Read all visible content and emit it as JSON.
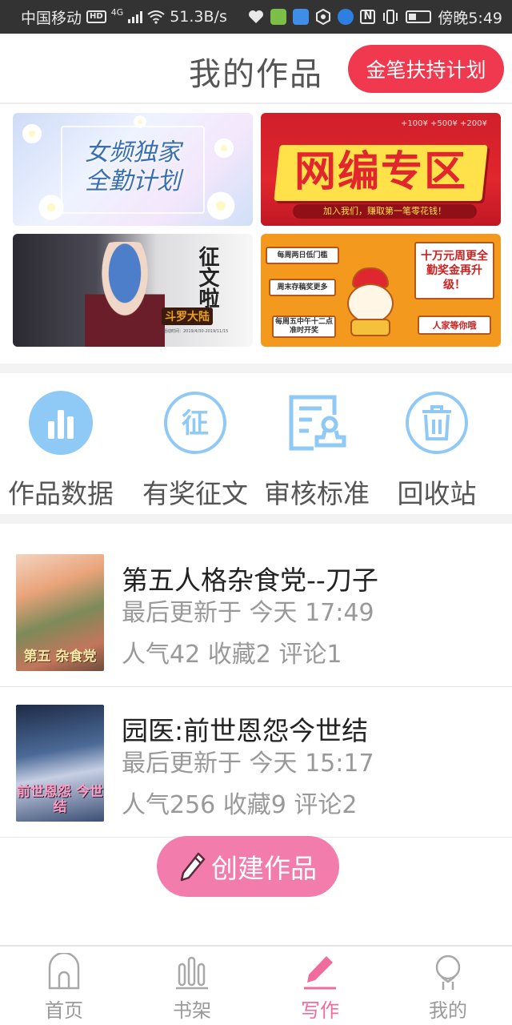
{
  "status_bar": {
    "carrier": "中国移动",
    "hd_badge": "HD",
    "network": "4G",
    "speed": "51.3B/s",
    "time": "傍晚5:49"
  },
  "header": {
    "title": "我的作品",
    "plan_button": "金笔扶持计划"
  },
  "banners": [
    {
      "name": "女频独家全勤计划",
      "title_line1": "女频独家",
      "title_line2": "全勤计划",
      "bg_color": "#dfe8fb"
    },
    {
      "name": "网编专区",
      "title": "网编专区",
      "tagline": "加入我们，赚取第一笔零花钱！",
      "coins": "+100¥  +500¥  +200¥",
      "bg_color": "#d11f2a"
    },
    {
      "name": "征文啦 斗罗大陆",
      "title": "征文啦",
      "tag": "斗罗大陆",
      "sub": "活动时间：2019/4/30-2019/11/15",
      "bg_color": "#f7f7f7"
    },
    {
      "name": "十万元周更全勤奖金",
      "box1": "每周两日低门槛",
      "box2": "周末存稿奖更多",
      "box3": "每周五中午十二点准时开奖",
      "big": "十万元周更全勤奖金再升级！",
      "cta": "人家等你哦",
      "bg_color": "#f39a1e"
    }
  ],
  "features": [
    {
      "label": "作品数据",
      "icon": "bar-chart-icon"
    },
    {
      "label": "有奖征文",
      "icon": "contest-icon",
      "glyph": "征"
    },
    {
      "label": "审核标准",
      "icon": "review-standard-icon"
    },
    {
      "label": "回收站",
      "icon": "trash-icon"
    }
  ],
  "works": [
    {
      "title": "第五人格杂食党--刀子",
      "updated": "最后更新于 今天 17:49",
      "stats": "人气42 收藏2 评论1",
      "cover_text": "第五 杂食党"
    },
    {
      "title": "园医:前世恩怨今世结",
      "updated": "最后更新于 今天 15:17",
      "stats": "人气256 收藏9 评论2",
      "cover_text": "前世恩怨 今世结"
    }
  ],
  "create_button": "创建作品",
  "tabs": [
    {
      "label": "首页",
      "icon": "home-icon",
      "active": false
    },
    {
      "label": "书架",
      "icon": "bookshelf-icon",
      "active": false
    },
    {
      "label": "写作",
      "icon": "pencil-icon",
      "active": true
    },
    {
      "label": "我的",
      "icon": "profile-icon",
      "active": false
    }
  ],
  "colors": {
    "accent_pink": "#ef6c9d",
    "plan_red": "#f0394f",
    "feature_blue": "#8fc9f5"
  }
}
